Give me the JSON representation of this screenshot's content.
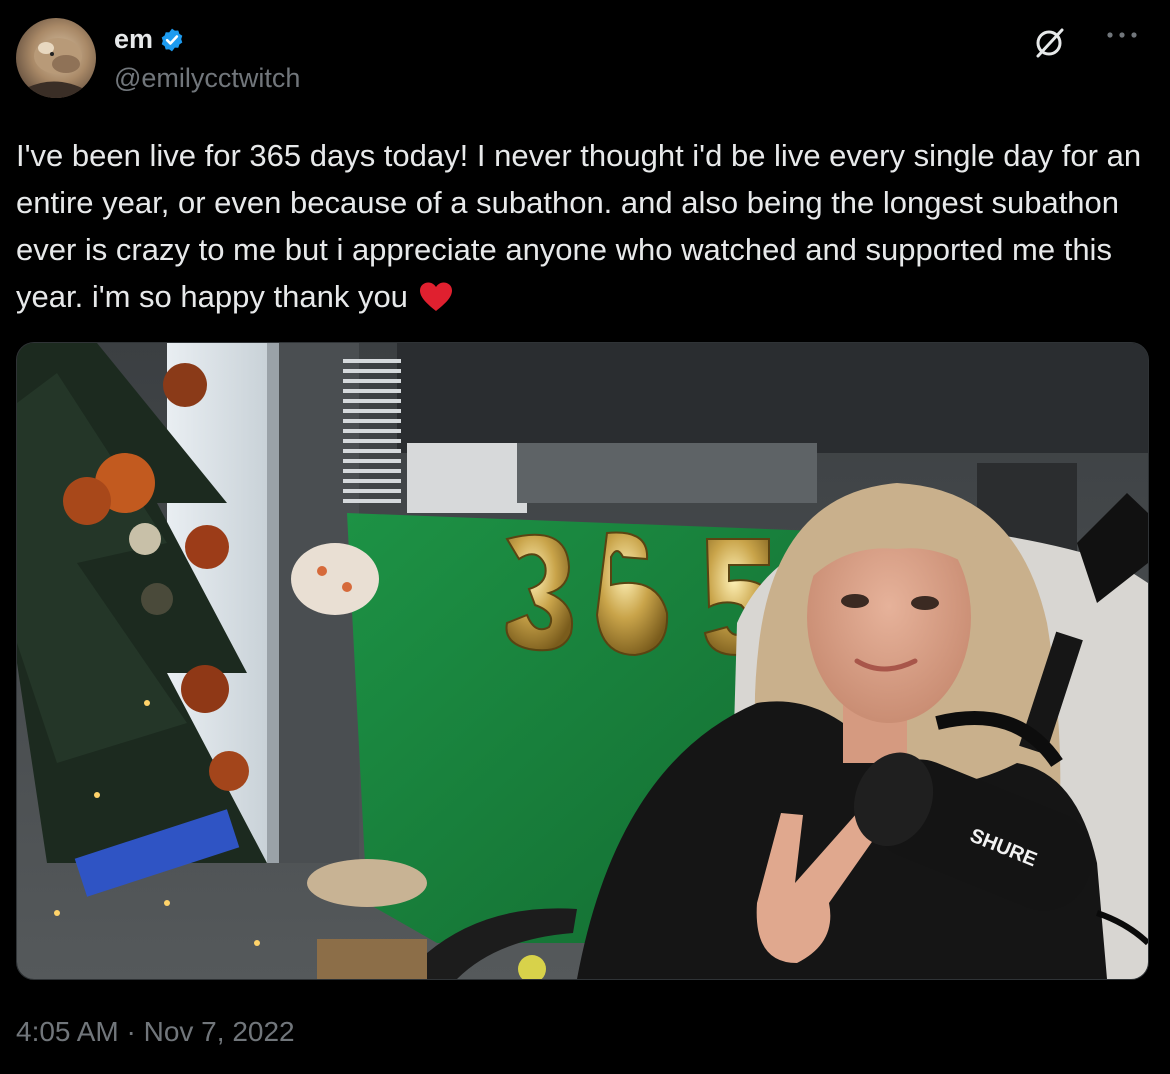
{
  "author": {
    "display_name": "em",
    "handle": "@emilycctwitch",
    "verified": true,
    "verified_color": "#1d9bf0",
    "avatar_icon": "avatar-photo"
  },
  "header_actions": {
    "grok_icon": "grok-icon",
    "more_icon": "more-horizontal-icon"
  },
  "tweet": {
    "text": "I've been live for 365 days today! I never thought i'd be live every single day for an entire year, or even because of a subathon. and also being the longest subathon ever is crazy to me but i appreciate anyone who watched and supported me this year. i'm so happy thank you",
    "emoji": "red-heart",
    "emoji_color": "#e0202f"
  },
  "media": {
    "type": "photo",
    "balloon_text": "365",
    "mic_brand": "SHURE"
  },
  "timestamp": "4:05 AM · Nov 7, 2022",
  "colors": {
    "background": "#000000",
    "text": "#e7e9ea",
    "secondary": "#71767b",
    "green_screen": "#1f8a43"
  }
}
